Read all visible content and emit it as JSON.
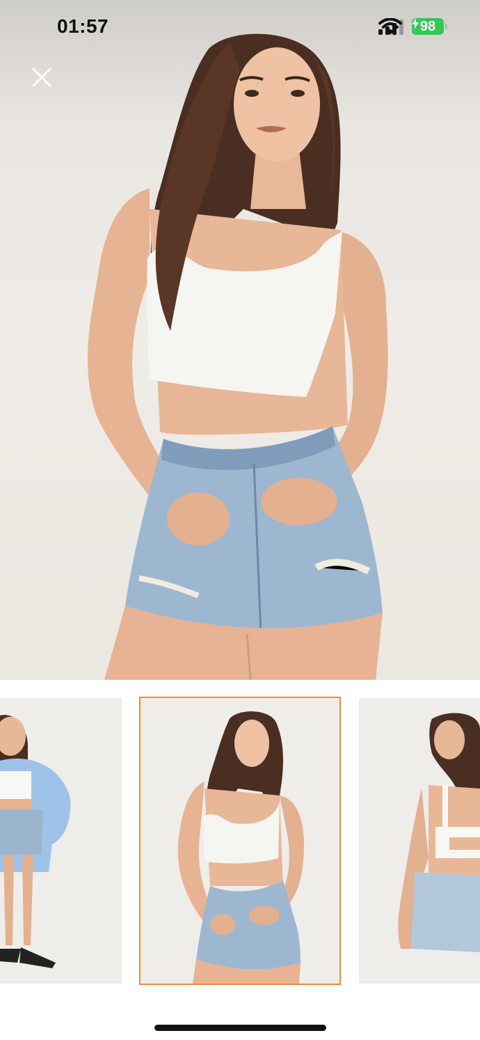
{
  "status_bar": {
    "time": "01:57",
    "battery": "98",
    "icons": [
      "signal-icon",
      "wifi-icon",
      "battery-charging-icon"
    ],
    "battery_color": "#34c759"
  },
  "header": {
    "close_icon": "close-icon"
  },
  "gallery": {
    "selected_index": 1,
    "selected_border_color": "#ee8a3c",
    "thumbnails": [
      {
        "label": "product-image-1"
      },
      {
        "label": "product-image-2"
      },
      {
        "label": "product-image-3"
      }
    ]
  }
}
